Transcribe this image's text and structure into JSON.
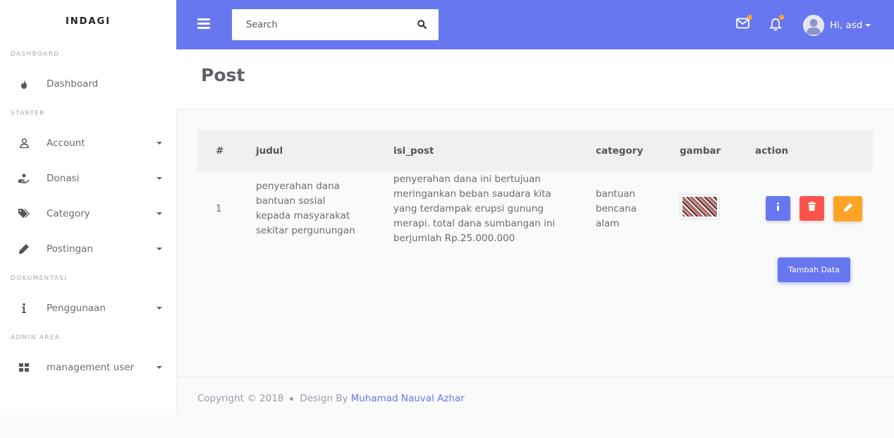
{
  "sidebar": {
    "brand": "INDAGI",
    "sections": [
      {
        "title": "DASHBOARD",
        "items": [
          {
            "label": "Dashboard",
            "icon": "fire-icon",
            "has_caret": false
          }
        ]
      },
      {
        "title": "STARTER",
        "items": [
          {
            "label": "Account",
            "icon": "user-icon",
            "has_caret": true
          },
          {
            "label": "Donasi",
            "icon": "hand-holding-icon",
            "has_caret": true
          },
          {
            "label": "Category",
            "icon": "tags-icon",
            "has_caret": true
          },
          {
            "label": "Postingan",
            "icon": "pencil-icon",
            "has_caret": true
          }
        ]
      },
      {
        "title": "DOKUMENTASI",
        "items": [
          {
            "label": "Penggunaan",
            "icon": "info-icon",
            "has_caret": true
          }
        ]
      },
      {
        "title": "ADMIN AREA",
        "items": [
          {
            "label": "management user",
            "icon": "grid-icon",
            "has_caret": true
          }
        ]
      }
    ]
  },
  "topbar": {
    "search_placeholder": "Search",
    "user_greeting": "Hi, asd"
  },
  "header": {
    "title": "Post"
  },
  "table": {
    "columns": [
      "#",
      "judul",
      "isi_post",
      "category",
      "gambar",
      "action"
    ],
    "rows": [
      {
        "num": "1",
        "judul": "penyerahan dana bantuan sosial kepada masyarakat sekitar pergunungan",
        "isi_post": "penyerahan dana ini bertujuan meringankan beban saudara kita yang terdampak erupsi gunung merapi. total dana sumbangan ini berjumlah Rp.25.000.000",
        "category": "bantuan bencana alam"
      }
    ]
  },
  "add_button": "Tambah Data",
  "footer": {
    "copyright": "Copyright © 2018",
    "design_by": "Design By",
    "author": "Muhamad Nauval Azhar"
  },
  "colors": {
    "primary": "#6777ef",
    "danger": "#fc544b",
    "warning": "#ffa426"
  }
}
